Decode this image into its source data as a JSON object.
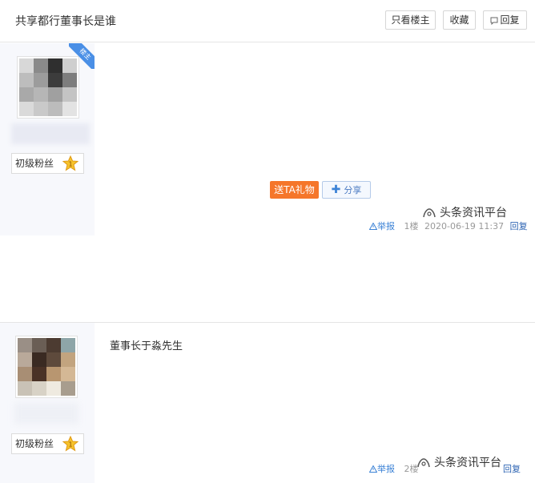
{
  "header": {
    "title": "共享都行董事长是谁",
    "only_author_label": "只看楼主",
    "favorite_label": "收藏",
    "reply_label": "回复"
  },
  "posts": [
    {
      "badge": "楼主",
      "level": "初级粉丝",
      "content": "",
      "gift_label": "送TA礼物",
      "share_label": "分享",
      "report_label": "举报",
      "floor": "1楼",
      "timestamp": "2020-06-19 11:37",
      "reply_label": "回复",
      "watermark": "头条资讯平台"
    },
    {
      "level": "初级粉丝",
      "content": "董事长于淼先生",
      "report_label": "举报",
      "floor": "2楼",
      "reply_label": "回复",
      "watermark": "头条资讯平台"
    }
  ],
  "colors": {
    "accent_blue": "#3b82d6",
    "gift_orange": "#f5762a",
    "author_panel": "#f7f8fc",
    "badge_blue": "#4a8fe6"
  },
  "icons": [
    "reply-icon",
    "star-badge-icon",
    "warning-icon",
    "plus-icon",
    "watermark-logo-icon"
  ]
}
